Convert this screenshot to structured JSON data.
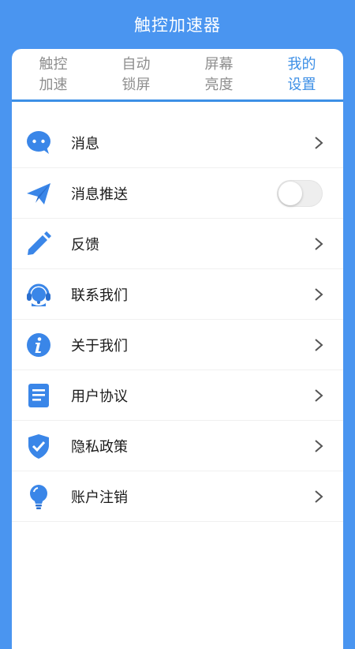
{
  "app": {
    "title": "触控加速器"
  },
  "tabs": [
    {
      "label": "触控加速",
      "active": false
    },
    {
      "label": "自动锁屏",
      "active": false
    },
    {
      "label": "屏幕亮度",
      "active": false
    },
    {
      "label": "我的设置",
      "active": true
    }
  ],
  "settings": {
    "items": [
      {
        "label": "消息",
        "icon": "chat-bubble-icon",
        "control": "chevron"
      },
      {
        "label": "消息推送",
        "icon": "paper-plane-icon",
        "control": "toggle",
        "toggle_on": false
      },
      {
        "label": "反馈",
        "icon": "pencil-icon",
        "control": "chevron"
      },
      {
        "label": "联系我们",
        "icon": "headset-icon",
        "control": "chevron"
      },
      {
        "label": "关于我们",
        "icon": "info-icon",
        "control": "chevron"
      },
      {
        "label": "用户协议",
        "icon": "document-icon",
        "control": "chevron"
      },
      {
        "label": "隐私政策",
        "icon": "shield-check-icon",
        "control": "chevron"
      },
      {
        "label": "账户注销",
        "icon": "lightbulb-icon",
        "control": "chevron"
      }
    ]
  },
  "colors": {
    "accent": "#3d8fe6",
    "background": "#4a95f0",
    "icon": "#3a86e8",
    "inactive_tab_text": "#8e8e8e"
  }
}
